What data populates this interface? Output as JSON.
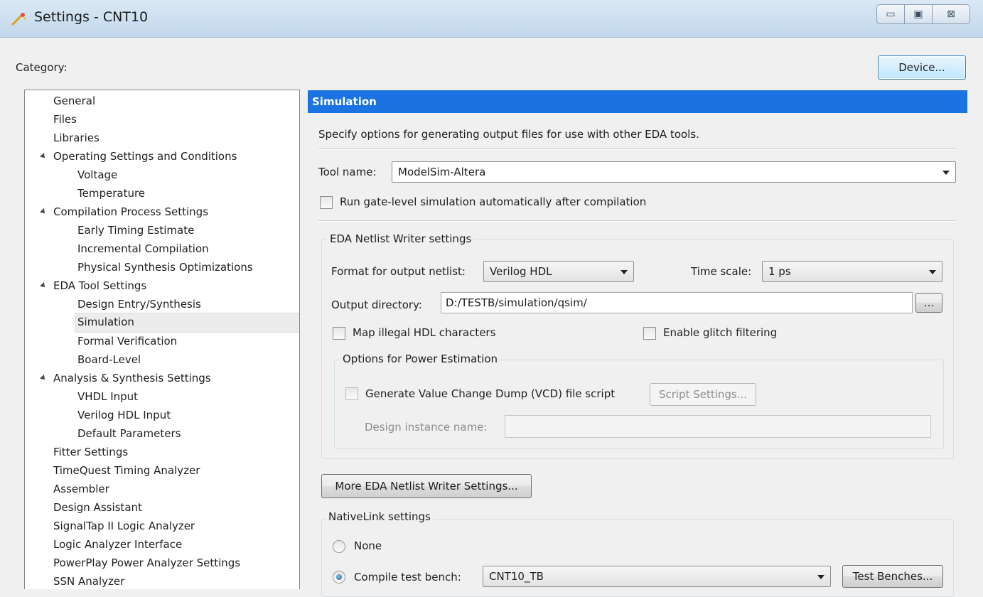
{
  "window": {
    "title": "Settings - CNT10",
    "min_glyph": "▭",
    "max_glyph": "▣",
    "close_glyph": "⊠"
  },
  "category_label": "Category:",
  "device_button": "Device...",
  "tree": [
    {
      "label": "General"
    },
    {
      "label": "Files"
    },
    {
      "label": "Libraries"
    },
    {
      "label": "Operating Settings and Conditions"
    },
    {
      "label": "Voltage"
    },
    {
      "label": "Temperature"
    },
    {
      "label": "Compilation Process Settings"
    },
    {
      "label": "Early Timing Estimate"
    },
    {
      "label": "Incremental Compilation"
    },
    {
      "label": "Physical Synthesis Optimizations"
    },
    {
      "label": "EDA Tool Settings"
    },
    {
      "label": "Design Entry/Synthesis"
    },
    {
      "label": "Simulation"
    },
    {
      "label": "Formal Verification"
    },
    {
      "label": "Board-Level"
    },
    {
      "label": "Analysis & Synthesis Settings"
    },
    {
      "label": "VHDL Input"
    },
    {
      "label": "Verilog HDL Input"
    },
    {
      "label": "Default Parameters"
    },
    {
      "label": "Fitter Settings"
    },
    {
      "label": "TimeQuest Timing Analyzer"
    },
    {
      "label": "Assembler"
    },
    {
      "label": "Design Assistant"
    },
    {
      "label": "SignalTap II Logic Analyzer"
    },
    {
      "label": "Logic Analyzer Interface"
    },
    {
      "label": "PowerPlay Power Analyzer Settings"
    },
    {
      "label": "SSN Analyzer"
    }
  ],
  "panel": {
    "header": "Simulation",
    "description": "Specify options for generating output files for use with other EDA tools.",
    "tool_name_label": "Tool name:",
    "tool_name_value": "ModelSim-Altera",
    "run_gate_level": "Run gate-level simulation automatically after compilation",
    "eda_group_title": "EDA Netlist Writer settings",
    "format_label": "Format for output netlist:",
    "format_value": "Verilog HDL",
    "time_scale_label": "Time scale:",
    "time_scale_value": "1 ps",
    "output_dir_label": "Output directory:",
    "output_dir_value": "D:/TESTB/simulation/qsim/",
    "browse_button": "...",
    "map_illegal": "Map illegal HDL characters",
    "enable_glitch": "Enable glitch filtering",
    "power_group_title": "Options for Power Estimation",
    "generate_vcd": "Generate Value Change Dump (VCD) file script",
    "script_settings_button": "Script Settings...",
    "design_instance_label": "Design instance name:",
    "design_instance_value": "",
    "more_eda_button": "More EDA Netlist Writer Settings...",
    "nativelink_title": "NativeLink settings",
    "none_label": "None",
    "compile_tb_label": "Compile test bench:",
    "compile_tb_value": "CNT10_TB",
    "test_benches_button": "Test Benches..."
  }
}
